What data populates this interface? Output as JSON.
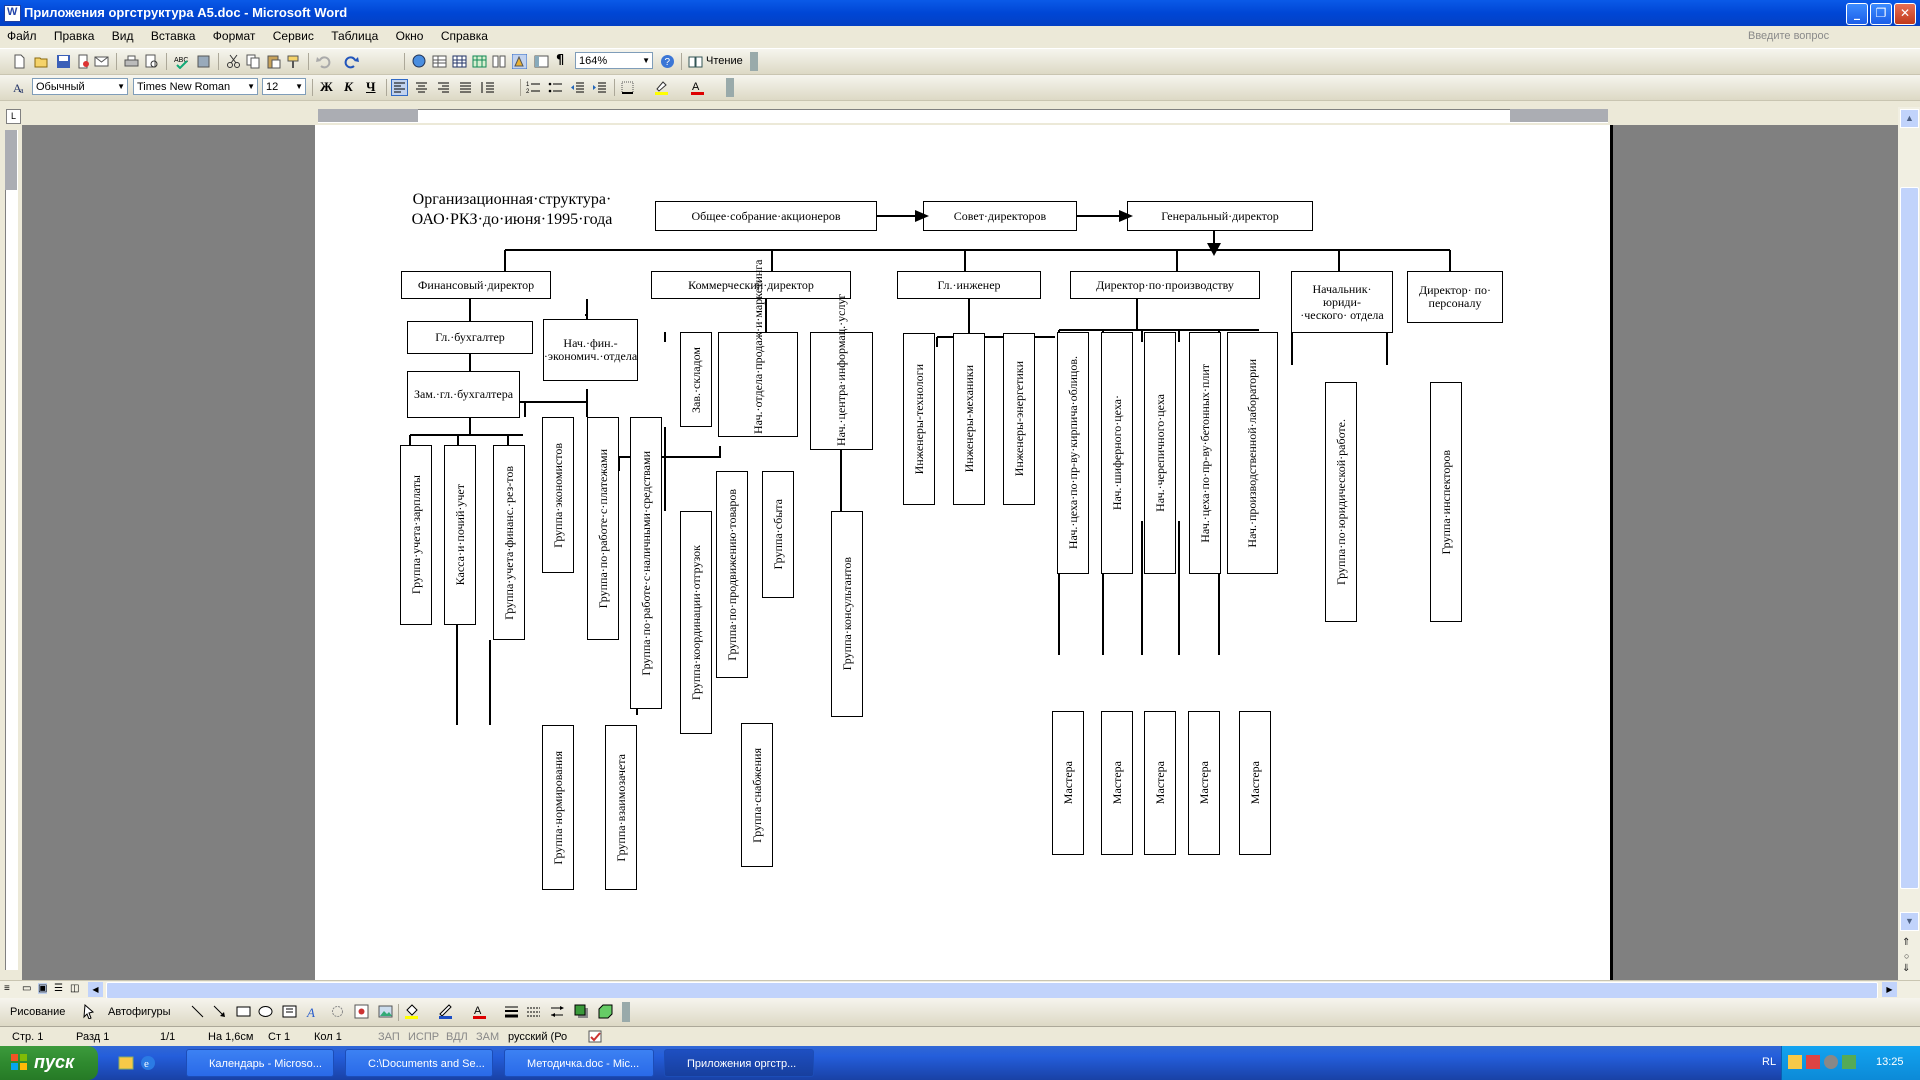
{
  "window": {
    "title": "Приложения оргструктура А5.doc - Microsoft Word"
  },
  "menu": {
    "items": [
      "Файл",
      "Правка",
      "Вид",
      "Вставка",
      "Формат",
      "Сервис",
      "Таблица",
      "Окно",
      "Справка"
    ],
    "help_placeholder": "Введите вопрос"
  },
  "toolbar": {
    "zoom": "164%",
    "reading_label": "Чтение",
    "style": "Обычный",
    "font": "Times New Roman",
    "size": "12"
  },
  "document": {
    "title_line1": "Организационная·структура·",
    "title_line2": "ОАО·РКЗ·до·июня·1995·года",
    "top": [
      "Общее·собрание·акционеров",
      "Совет·директоров",
      "Генеральный·директор"
    ],
    "directors": [
      "Финансовый·директор",
      "Коммерческий·директор",
      "Гл.·инженер",
      "Директор·по·производству",
      "Начальник· юриди-·ческого· отдела",
      "Директор· по· персоналу"
    ],
    "finance": {
      "chief_accountant": "Гл.·бухгалтер",
      "deputy_accountant": "Зам.·гл.·бухгалтера",
      "econ_dept": "Нач.·фин.-·экономич.·отдела",
      "acc_groups": [
        "Группа·учета·зарплаты",
        "Касса·и·почий·учет",
        "Группа·учета·финанс.·рез-тов"
      ],
      "econ_groups": [
        "Группа·экономистов",
        "Группа·по·работе·с·платежами",
        "Группа·по·работе·с·наличными·средствами"
      ],
      "lower_groups": [
        "Группа·нормирования",
        "Группа·взаимозачета"
      ]
    },
    "commercial": {
      "warehouse": "Зав.·складом",
      "sales_marketing": "Нач.·отдела·продаж·и·маркетинга",
      "info_center": "Нач.·центра·информац.·услуг",
      "shipping_group": "Группа·координации·отгрузок",
      "promotion_group": "Группа·по·продвижению·товаров",
      "sales_group": "Группа·сбыта",
      "consultants_group": "Группа·консультантов",
      "supply_group": "Группа·снабжения"
    },
    "engineer": {
      "groups": [
        "Инженеры-технологи",
        "Инженеры-механики",
        "Инженеры-энергетики"
      ]
    },
    "production": {
      "heads": [
        "Нач.·цеха·по·пр-ву·кирпича·облицов.",
        "Нач.·шиферного·цеха·",
        "Нач.·черепичного·цеха",
        "Нач.·цеха·по·пр-ву·бетонных·плит",
        "Нач.·производственной·лаборатории"
      ],
      "masters": [
        "Мастера",
        "Мастера",
        "Мастера",
        "Мастера",
        "Мастера"
      ]
    },
    "legal": {
      "group": "Группа·по·юридической·работе."
    },
    "personnel": {
      "group": "Группа·инспекторов"
    }
  },
  "drawing": {
    "draw_label": "Рисование",
    "autoshapes_label": "Автофигуры"
  },
  "status": {
    "page": "Стр. 1",
    "section": "Разд 1",
    "pages": "1/1",
    "at": "На 1,6см",
    "line": "Ст 1",
    "col": "Кол 1",
    "rec": "ЗАП",
    "trk": "ИСПР",
    "ext": "ВДЛ",
    "ovr": "ЗАМ",
    "lang": "русский (Ро"
  },
  "taskbar": {
    "start": "пуск",
    "tasks": [
      "Календарь - Microso...",
      "C:\\Documents and Se...",
      "Методичка.doc - Mic...",
      "Приложения оргстр..."
    ],
    "lang": "RL",
    "time": "13:25"
  }
}
